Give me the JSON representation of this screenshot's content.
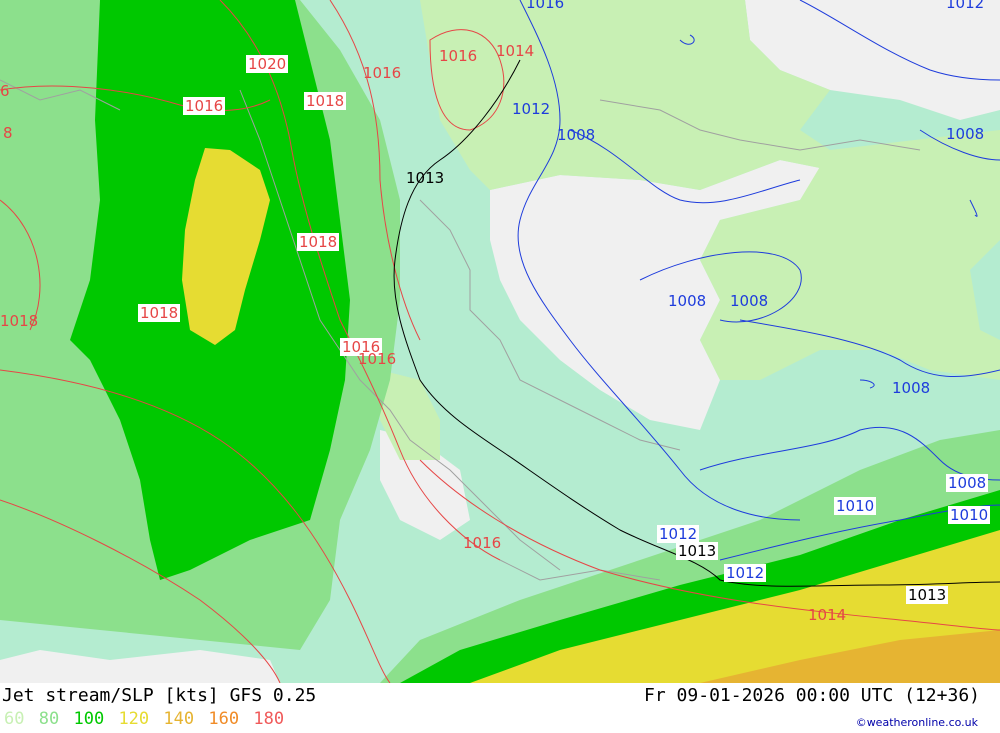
{
  "header": {
    "title": "Jet stream/SLP [kts] GFS 0.25",
    "valid_time": "Fr 09-01-2026 00:00 UTC (12+36)",
    "credit": "©weatheronline.co.uk"
  },
  "legend": {
    "items": [
      {
        "label": "60",
        "color": "#c8f0b4"
      },
      {
        "label": "80",
        "color": "#8ce08c"
      },
      {
        "label": "100",
        "color": "#00c800"
      },
      {
        "label": "120",
        "color": "#e6dc32"
      },
      {
        "label": "140",
        "color": "#e6b432"
      },
      {
        "label": "160",
        "color": "#f08c28"
      },
      {
        "label": "180",
        "color": "#f05a5a"
      }
    ]
  },
  "isobar_labels": {
    "red_1": "1020",
    "red_2": "1016",
    "red_3": "1016",
    "red_4": "1018",
    "red_5": "1016",
    "red_6": "1014",
    "red_7": "1018",
    "red_8": "1018",
    "red_9": "1016",
    "red_10": "1016",
    "red_11": "1016",
    "red_12": "1014",
    "red_13": "1018",
    "red_14": "6",
    "red_15": "8",
    "black_1": "1013",
    "black_2": "1013",
    "black_3": "1013",
    "blue_1": "1012",
    "blue_2": "1008",
    "blue_3": "1008",
    "blue_4": "1008",
    "blue_5": "1008",
    "blue_6": "1008",
    "blue_7": "1008",
    "blue_8": "1010",
    "blue_9": "1010",
    "blue_10": "1012",
    "blue_11": "1012",
    "blue_12": "1016",
    "blue_13": "1012"
  },
  "colors": {
    "low_speed": "#b4ecd0",
    "speed_60": "#c8f0b4",
    "speed_80": "#8ce08c",
    "speed_100": "#00c800",
    "speed_120": "#e6dc32",
    "speed_140": "#e6b432",
    "land_background": "#f0f0f0",
    "isobar_high": "#e64646",
    "isobar_low": "#1e3cdc",
    "isobar_1013": "#000000",
    "coastline": "#a0a0a0"
  }
}
